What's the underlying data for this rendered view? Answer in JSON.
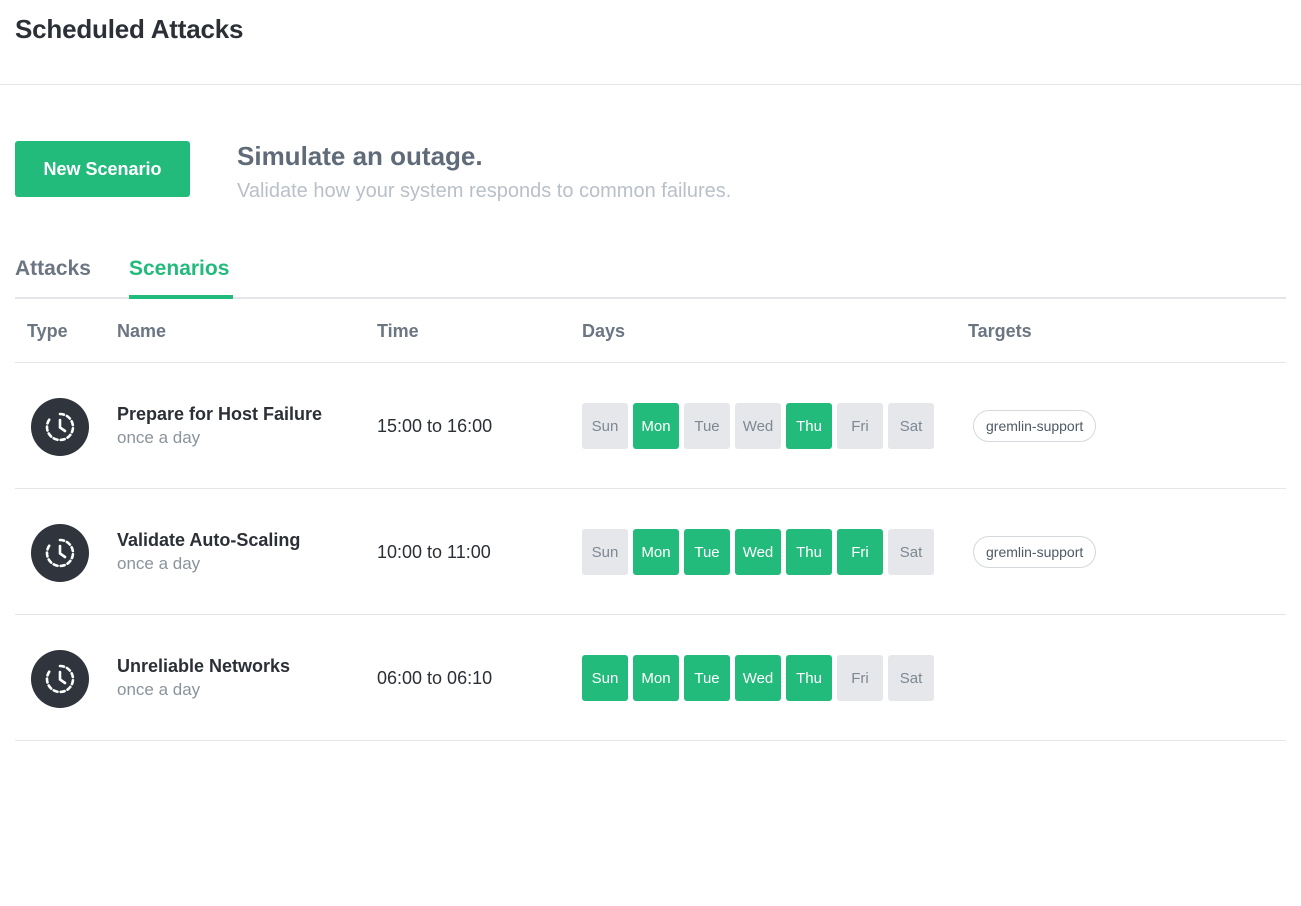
{
  "header": {
    "title": "Scheduled Attacks"
  },
  "promo": {
    "button_label": "New Scenario",
    "title": "Simulate an outage.",
    "subtitle": "Validate how your system responds to common failures."
  },
  "tabs": [
    {
      "label": "Attacks",
      "active": false
    },
    {
      "label": "Scenarios",
      "active": true
    }
  ],
  "table": {
    "columns": [
      "Type",
      "Name",
      "Time",
      "Days",
      "Targets"
    ],
    "rows": [
      {
        "type_icon": "clock-icon",
        "name": "Prepare for Host Failure",
        "frequency": "once a day",
        "time": "15:00 to 16:00",
        "days": [
          {
            "label": "Sun",
            "active": false
          },
          {
            "label": "Mon",
            "active": true
          },
          {
            "label": "Tue",
            "active": false
          },
          {
            "label": "Wed",
            "active": false
          },
          {
            "label": "Thu",
            "active": true
          },
          {
            "label": "Fri",
            "active": false
          },
          {
            "label": "Sat",
            "active": false
          }
        ],
        "target": "gremlin-support"
      },
      {
        "type_icon": "clock-icon",
        "name": "Validate Auto-Scaling",
        "frequency": "once a day",
        "time": "10:00 to 11:00",
        "days": [
          {
            "label": "Sun",
            "active": false
          },
          {
            "label": "Mon",
            "active": true
          },
          {
            "label": "Tue",
            "active": true
          },
          {
            "label": "Wed",
            "active": true
          },
          {
            "label": "Thu",
            "active": true
          },
          {
            "label": "Fri",
            "active": true
          },
          {
            "label": "Sat",
            "active": false
          }
        ],
        "target": "gremlin-support"
      },
      {
        "type_icon": "clock-icon",
        "name": "Unreliable Networks",
        "frequency": "once a day",
        "time": "06:00 to 06:10",
        "days": [
          {
            "label": "Sun",
            "active": true
          },
          {
            "label": "Mon",
            "active": true
          },
          {
            "label": "Tue",
            "active": true
          },
          {
            "label": "Wed",
            "active": true
          },
          {
            "label": "Thu",
            "active": true
          },
          {
            "label": "Fri",
            "active": false
          },
          {
            "label": "Sat",
            "active": false
          }
        ],
        "target": ""
      }
    ]
  },
  "colors": {
    "accent": "#22bb7c",
    "icon_bg": "#2f343d",
    "inactive_day": "#e5e7ea"
  }
}
